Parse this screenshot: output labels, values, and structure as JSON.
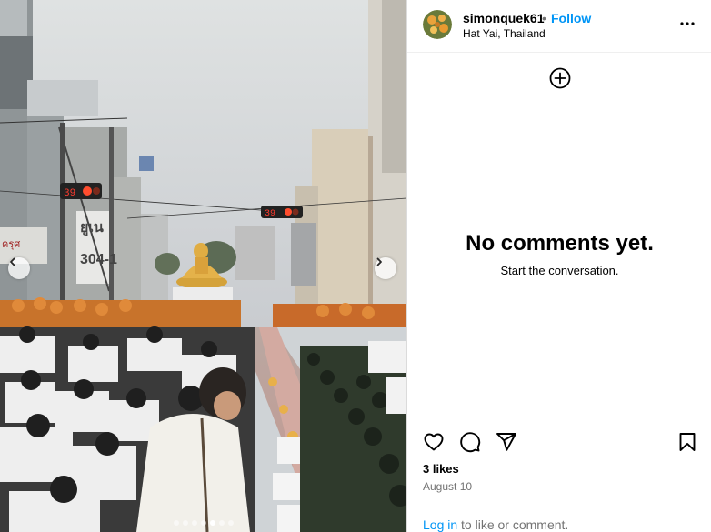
{
  "post": {
    "username": "simonquek61",
    "separator": "•",
    "follow_label": "Follow",
    "location": "Hat Yai, Thailand",
    "more_icon": "more-horizontal-icon"
  },
  "comments": {
    "empty_title": "No comments yet.",
    "empty_subtitle": "Start the conversation."
  },
  "photo": {
    "timer_left": "39",
    "timer_right": "39",
    "sign_text": "ยูเน\n304-1",
    "shop_text": "ครุศ",
    "carousel_total": 7,
    "carousel_active": 5
  },
  "engagement": {
    "likes": "3 likes",
    "date": "August 10",
    "login_link": "Log in",
    "login_rest": " to like or comment."
  },
  "colors": {
    "link_blue": "#0095f6",
    "secondary_text": "#737373",
    "border": "#dbdbdb"
  }
}
